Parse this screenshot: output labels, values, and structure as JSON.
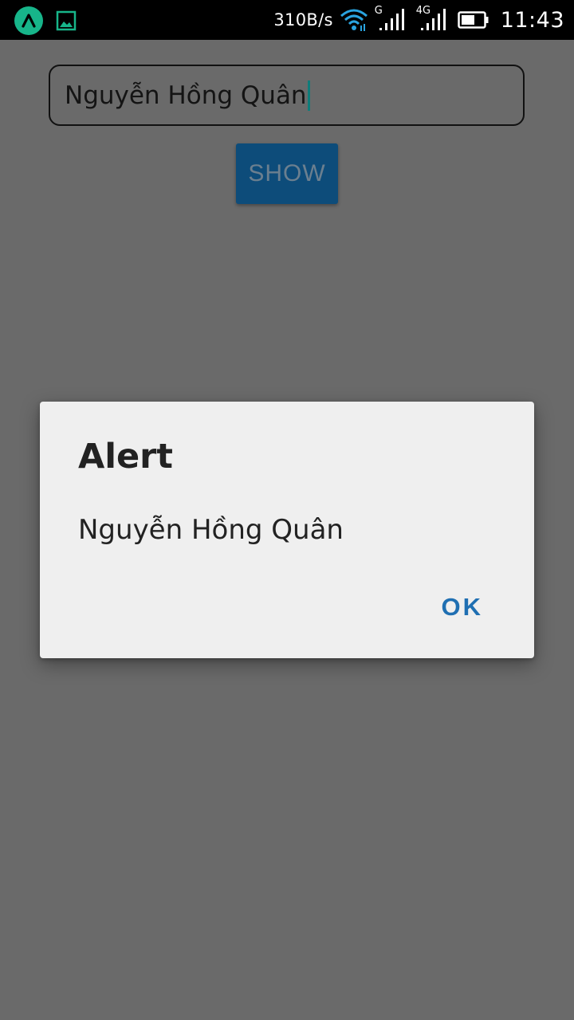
{
  "status_bar": {
    "network_speed": "310B/s",
    "sim1_label": "G",
    "sim2_label": "4G",
    "time": "11:43",
    "icons": [
      "app-logo-icon",
      "gallery-icon",
      "wifi-icon",
      "signal-icon",
      "signal-icon",
      "battery-icon"
    ],
    "battery_level": 0.6
  },
  "form": {
    "name_input_value": "Nguyễn Hồng Quân",
    "show_button_label": "SHOW"
  },
  "dialog": {
    "title": "Alert",
    "message": "Nguyễn Hồng Quân",
    "ok_label": "OK"
  },
  "colors": {
    "scrim_background": "#6a6a6a",
    "dialog_background": "#efefef",
    "accent": "#1f6fb2",
    "button_dimmed": "#0d4c7a",
    "app_icon": "#17b58a"
  }
}
